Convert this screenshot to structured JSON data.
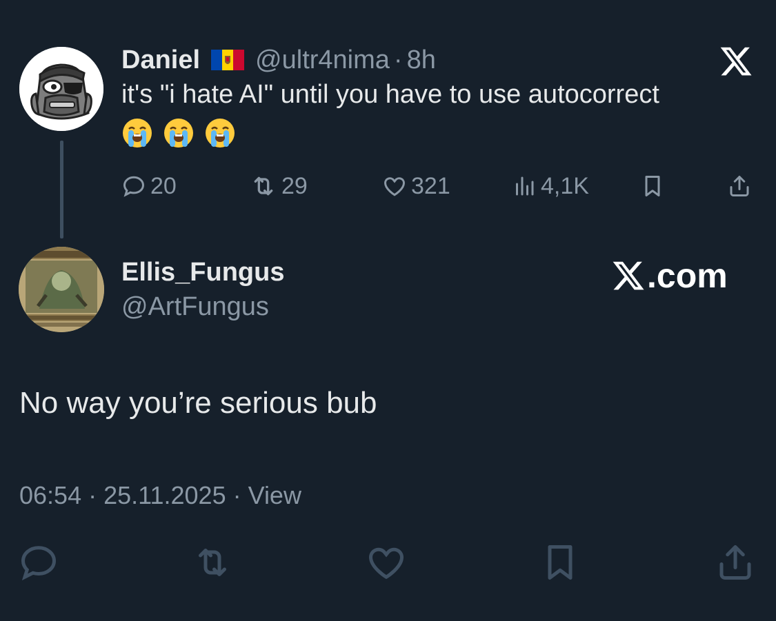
{
  "quoted_tweet": {
    "author_name": "Daniel",
    "flag_icon": "moldova-flag-icon",
    "handle": "@ultr4nima",
    "separator": "·",
    "time": "8h",
    "text": "it's \"i hate AI\" until you have to use autocorrect",
    "emojis": [
      "😭",
      "😭",
      "😭"
    ],
    "stats": {
      "replies": "20",
      "reposts": "29",
      "likes": "321",
      "views": "4,1K"
    }
  },
  "reply_tweet": {
    "author_name": "Ellis_Fungus",
    "handle": "@ArtFungus",
    "brand_domain": ".com",
    "text": "No way you’re serious bub",
    "meta": "06:54 · 25.11.2025 · View"
  },
  "colors": {
    "background": "#16202b",
    "text_primary": "#e7e9ea",
    "text_secondary": "#8b98a5",
    "thread_line": "#3e4f60",
    "action_icon": "#8b98a5",
    "bottom_action_icon": "#3f5062"
  },
  "icons": {
    "reply": "reply-icon",
    "repost": "repost-icon",
    "like": "heart-icon",
    "views": "views-icon",
    "bookmark": "bookmark-icon",
    "share": "share-icon",
    "x_logo": "x-logo-icon"
  }
}
